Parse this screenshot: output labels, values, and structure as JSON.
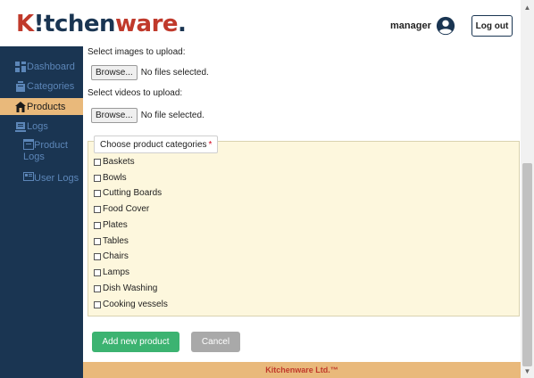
{
  "header": {
    "logo_k": "K",
    "logo_bang": "!",
    "logo_itchen": "tchen",
    "logo_ware": "ware",
    "logo_dot": ".",
    "username": "manager",
    "user_icon": "account-circle-icon",
    "logout_label": "Log out"
  },
  "sidebar": {
    "items": [
      {
        "label": "Dashboard",
        "icon": "dashboard-icon"
      },
      {
        "label": "Categories",
        "icon": "categories-icon"
      },
      {
        "label": "Products",
        "icon": "home-icon",
        "active": true
      },
      {
        "label": "Logs",
        "icon": "logs-icon"
      }
    ],
    "sub_items": [
      {
        "label": "Product",
        "label2": "Logs",
        "icon": "product-logs-icon"
      },
      {
        "label": "User Logs",
        "icon": "user-logs-icon"
      }
    ]
  },
  "form": {
    "images_label": "Select images to upload:",
    "images_button": "Browse...",
    "images_status": "No files selected.",
    "videos_label": "Select videos to upload:",
    "videos_button": "Browse...",
    "videos_status": "No file selected.",
    "categories_legend": "Choose product categories",
    "required_mark": "*",
    "categories": [
      "Baskets",
      "Bowls",
      "Cutting Boards",
      "Food Cover",
      "Plates",
      "Tables",
      "Chairs",
      "Lamps",
      "Dish Washing",
      "Cooking vessels"
    ],
    "add_label": "Add new product",
    "cancel_label": "Cancel"
  },
  "footer": {
    "text": "Kitchenware Ltd.™"
  },
  "colors": {
    "brand_red": "#c0392b",
    "navy": "#1a3552",
    "accent_orange": "#e9b97b",
    "green": "#3cb371",
    "gray_button": "#a9a9a9"
  }
}
